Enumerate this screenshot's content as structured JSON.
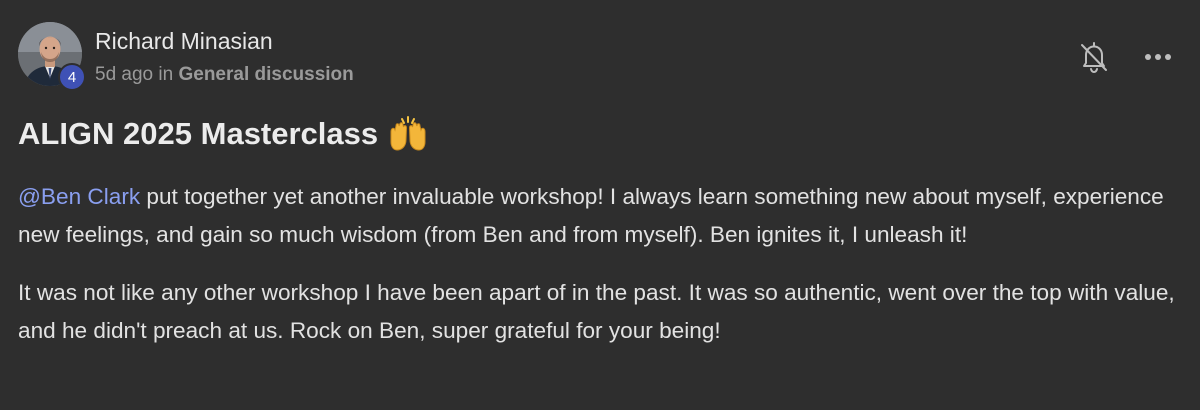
{
  "author": {
    "name": "Richard Minasian",
    "level": "4",
    "time_ago": "5d ago",
    "in_label": "in",
    "category": "General discussion"
  },
  "post": {
    "title": "ALIGN 2025 Masterclass",
    "title_emoji": "raising-hands-emoji",
    "paragraph1": {
      "mention": "@Ben Clark",
      "text": " put together yet another invaluable workshop! I always learn something new about myself, experience new feelings, and gain so much wisdom (from Ben and from myself). Ben ignites it, I unleash it!"
    },
    "paragraph2": "It was not like any other workshop I have been apart of in the past. It was so authentic, went over the top with value, and he didn't preach at us. Rock on Ben, super grateful for your being!"
  },
  "icons": {
    "notifications": "bell-off-icon",
    "more": "more-horizontal-icon"
  },
  "colors": {
    "background": "#2e2e2e",
    "mention": "#8a9ff0",
    "level_badge": "#3f51b5",
    "muted_text": "#9a9a9a"
  }
}
